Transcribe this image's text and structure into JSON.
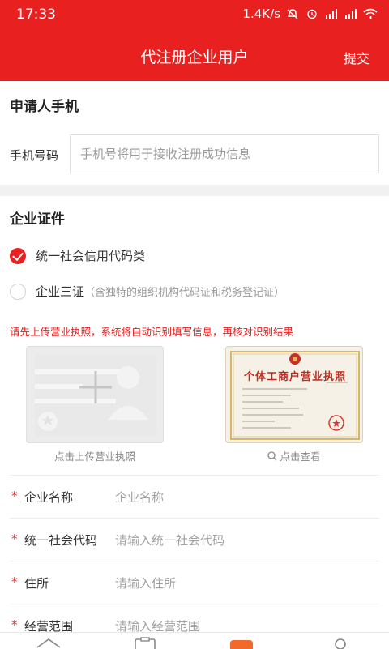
{
  "status_bar": {
    "time": "17:33",
    "network_speed": "1.4K/s",
    "icons": [
      "mute-icon",
      "alarm-icon",
      "signal-icon",
      "signal-icon",
      "wifi-icon",
      "battery-icon"
    ]
  },
  "nav": {
    "title": "代注册企业用户",
    "submit_label": "提交",
    "background_color": "#e8201f"
  },
  "applicant": {
    "section_title": "申请人手机",
    "phone_label": "手机号码",
    "phone_placeholder": "手机号将用于接收注册成功信息",
    "phone_value": ""
  },
  "certificate": {
    "section_title": "企业证件",
    "options": [
      {
        "label": "统一社会信用代码类",
        "hint": "",
        "selected": true
      },
      {
        "label": "企业三证",
        "hint": "（含独特的组织机构代码证和税务登记证）",
        "selected": false
      }
    ],
    "notice": "请先上传营业执照，系统将自动识别填写信息，再核对识别结果",
    "upload_caption": "点击上传营业执照",
    "sample_title": "个体工商户营业执照",
    "view_caption": "点击查看"
  },
  "form_fields": [
    {
      "label": "企业名称",
      "placeholder": "企业名称",
      "required": true
    },
    {
      "label": "统一社会代码",
      "placeholder": "请输入统一社会代码",
      "required": true
    },
    {
      "label": "住所",
      "placeholder": "请输入住所",
      "required": true
    },
    {
      "label": "经营范围",
      "placeholder": "请输入经营范围",
      "required": true
    }
  ],
  "tab_bar": {
    "icons": [
      "home-icon",
      "clipboard-icon",
      "app-icon",
      "profile-icon"
    ]
  }
}
